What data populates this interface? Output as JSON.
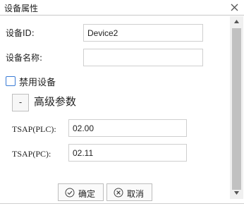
{
  "dialog": {
    "title": "设备属性"
  },
  "form": {
    "device_id_label": "设备ID:",
    "device_id_value": "Device2",
    "device_name_label": "设备名称:",
    "device_name_value": "",
    "disable_label": "禁用设备",
    "disable_checked": false
  },
  "advanced": {
    "toggle_symbol": "-",
    "title": "高级参数",
    "tsap_plc_label": "TSAP(PLC):",
    "tsap_plc_value": "02.00",
    "tsap_pc_label": "TSAP(PC):",
    "tsap_pc_value": "02.11"
  },
  "buttons": {
    "ok_label": "确定",
    "cancel_label": "取消"
  },
  "icons": {
    "close": "close-icon",
    "ok": "check-circle-icon",
    "cancel": "x-circle-icon",
    "scroll_up": "arrow-up-icon",
    "scroll_down": "arrow-down-icon"
  }
}
